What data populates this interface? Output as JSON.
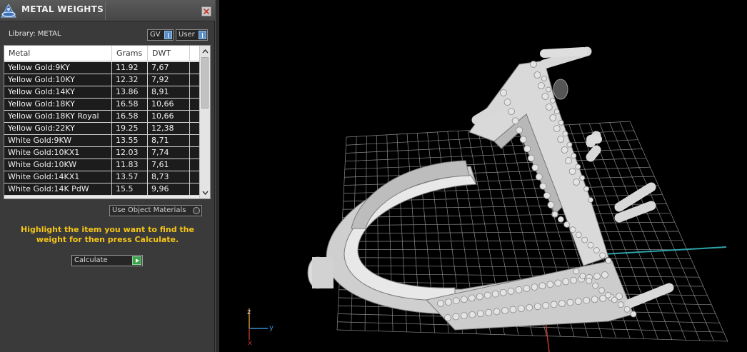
{
  "panel": {
    "title": "METAL WEIGHTS",
    "library_label": "Library: METAL",
    "gv_button": "GV",
    "user_button": "User",
    "table": {
      "headers": [
        "Metal",
        "Grams",
        "DWT"
      ],
      "rows": [
        [
          "Yellow Gold:9KY",
          "11.92",
          "7,67"
        ],
        [
          "Yellow Gold:10KY",
          "12.32",
          "7,92"
        ],
        [
          "Yellow Gold:14KY",
          "13.86",
          "8,91"
        ],
        [
          "Yellow Gold:18KY",
          "16.58",
          "10,66"
        ],
        [
          "Yellow Gold:18KY Royal",
          "16.58",
          "10,66"
        ],
        [
          "Yellow Gold:22KY",
          "19.25",
          "12,38"
        ],
        [
          "White Gold:9KW",
          "13.55",
          "8,71"
        ],
        [
          "White Gold:10KX1",
          "12.03",
          "7,74"
        ],
        [
          "White Gold:10KW",
          "11.83",
          "7,61"
        ],
        [
          "White Gold:14KX1",
          "13.57",
          "8,73"
        ],
        [
          "White Gold:14K PdW",
          "15.5",
          "9,96"
        ]
      ]
    },
    "use_object_materials": "Use Object Materials",
    "hint": "Highlight the item you want to find the weight for then press Calculate.",
    "calculate_button": "Calculate"
  },
  "viewport": {
    "axis_labels": {
      "z": "z",
      "y": "y",
      "x": "x"
    },
    "colors": {
      "grid": "#8a8a8a",
      "model": "#d6d6d6",
      "axis_x": "#c0392b",
      "axis_y": "#3a8fd0",
      "axis_z": "#e0a030",
      "cyan_line": "#2fa3a8"
    }
  },
  "colors": {
    "panel_bg": "#3a3a3a",
    "hint_text": "#f5c518",
    "row_bg": "#1c1c1c"
  }
}
